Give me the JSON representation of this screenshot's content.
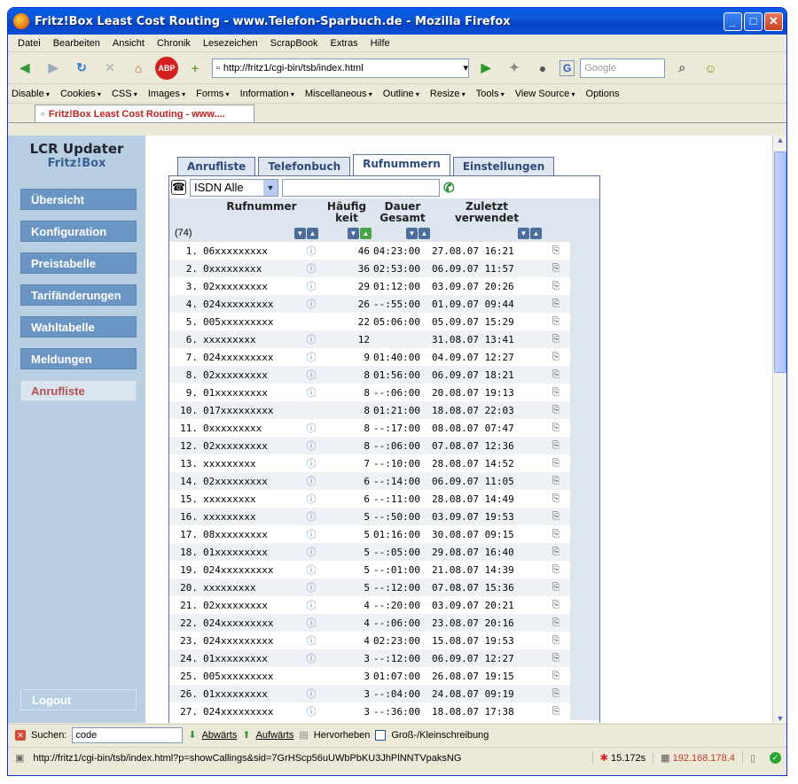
{
  "window": {
    "title": "Fritz!Box Least Cost Routing - www.Telefon-Sparbuch.de - Mozilla Firefox"
  },
  "menubar": [
    "Datei",
    "Bearbeiten",
    "Ansicht",
    "Chronik",
    "Lesezeichen",
    "ScrapBook",
    "Extras",
    "Hilfe"
  ],
  "navbar": {
    "url": "http://fritz1/cgi-bin/tsb/index.html",
    "search_engine": "G",
    "search_placeholder": "Google"
  },
  "devbar": [
    "Disable",
    "Cookies",
    "CSS",
    "Images",
    "Forms",
    "Information",
    "Miscellaneous",
    "Outline",
    "Resize",
    "Tools",
    "View Source",
    "Options"
  ],
  "browser_tab": {
    "label": "Fritz!Box Least Cost Routing - www...."
  },
  "sidebar": {
    "title": "LCR Updater",
    "subtitle": "Fritz!Box",
    "items": [
      {
        "label": "Übersicht",
        "active": false
      },
      {
        "label": "Konfiguration",
        "active": false
      },
      {
        "label": "Preistabelle",
        "active": false
      },
      {
        "label": "Tarifänderungen",
        "active": false
      },
      {
        "label": "Wahltabelle",
        "active": false
      },
      {
        "label": "Meldungen",
        "active": false
      },
      {
        "label": "Anrufliste",
        "active": true
      }
    ],
    "logout": "Logout"
  },
  "page_tabs": [
    {
      "label": "Anrufliste",
      "active": false
    },
    {
      "label": "Telefonbuch",
      "active": false
    },
    {
      "label": "Rufnummern",
      "active": true
    },
    {
      "label": "Einstellungen",
      "active": false
    }
  ],
  "filter": {
    "select_value": "ISDN Alle",
    "input_value": ""
  },
  "table": {
    "headers": {
      "number": "Rufnummer",
      "freq_line1": "Häufig",
      "freq_line2": "keit",
      "dur_line1": "Dauer",
      "dur_line2": "Gesamt",
      "last_line1": "Zuletzt",
      "last_line2": "verwendet"
    },
    "count": "(74)",
    "rows": [
      [
        "1.",
        "06xxxxxxxxx",
        true,
        "46",
        "04:23:00",
        "27.08.07 16:21"
      ],
      [
        "2.",
        "0xxxxxxxxx",
        true,
        "36",
        "02:53:00",
        "06.09.07 11:57"
      ],
      [
        "3.",
        "02xxxxxxxxx",
        true,
        "29",
        "01:12:00",
        "03.09.07 20:26"
      ],
      [
        "4.",
        "024xxxxxxxxx",
        true,
        "26",
        "--:55:00",
        "01.09.07 09:44"
      ],
      [
        "5.",
        "005xxxxxxxxx",
        false,
        "22",
        "05:06:00",
        "05.09.07 15:29"
      ],
      [
        "6.",
        "xxxxxxxxx",
        true,
        "12",
        "",
        "31.08.07 13:41"
      ],
      [
        "7.",
        "024xxxxxxxxx",
        true,
        "9",
        "01:40:00",
        "04.09.07 12:27"
      ],
      [
        "8.",
        "02xxxxxxxxx",
        true,
        "8",
        "01:56:00",
        "06.09.07 18:21"
      ],
      [
        "9.",
        "01xxxxxxxxx",
        true,
        "8",
        "--:06:00",
        "20.08.07 19:13"
      ],
      [
        "10.",
        "017xxxxxxxxx",
        false,
        "8",
        "01:21:00",
        "18.08.07 22:03"
      ],
      [
        "11.",
        "0xxxxxxxxx",
        true,
        "8",
        "--:17:00",
        "08.08.07 07:47"
      ],
      [
        "12.",
        "02xxxxxxxxx",
        true,
        "8",
        "--:06:00",
        "07.08.07 12:36"
      ],
      [
        "13.",
        "xxxxxxxxx",
        true,
        "7",
        "--:10:00",
        "28.08.07 14:52"
      ],
      [
        "14.",
        "02xxxxxxxxx",
        true,
        "6",
        "--:14:00",
        "06.09.07 11:05"
      ],
      [
        "15.",
        "xxxxxxxxx",
        true,
        "6",
        "--:11:00",
        "28.08.07 14:49"
      ],
      [
        "16.",
        "xxxxxxxxx",
        true,
        "5",
        "--:50:00",
        "03.09.07 19:53"
      ],
      [
        "17.",
        "08xxxxxxxxx",
        true,
        "5",
        "01:16:00",
        "30.08.07 09:15"
      ],
      [
        "18.",
        "01xxxxxxxxx",
        true,
        "5",
        "--:05:00",
        "29.08.07 16:40"
      ],
      [
        "19.",
        "024xxxxxxxxx",
        true,
        "5",
        "--:01:00",
        "21.08.07 14:39"
      ],
      [
        "20.",
        "xxxxxxxxx",
        true,
        "5",
        "--:12:00",
        "07.08.07 15:36"
      ],
      [
        "21.",
        "02xxxxxxxxx",
        true,
        "4",
        "--:20:00",
        "03.09.07 20:21"
      ],
      [
        "22.",
        "024xxxxxxxxx",
        true,
        "4",
        "--:06:00",
        "23.08.07 20:16"
      ],
      [
        "23.",
        "024xxxxxxxxx",
        true,
        "4",
        "02:23:00",
        "15.08.07 19:53"
      ],
      [
        "24.",
        "01xxxxxxxxx",
        true,
        "3",
        "--:12:00",
        "06.09.07 12:27"
      ],
      [
        "25.",
        "005xxxxxxxxx",
        false,
        "3",
        "01:07:00",
        "26.08.07 19:15"
      ],
      [
        "26.",
        "01xxxxxxxxx",
        true,
        "3",
        "--:04:00",
        "24.08.07 09:19"
      ],
      [
        "27.",
        "024xxxxxxxxx",
        true,
        "3",
        "--:36:00",
        "18.08.07 17:38"
      ]
    ]
  },
  "findbar": {
    "label": "Suchen:",
    "value": "code",
    "down": "Abwärts",
    "up": "Aufwärts",
    "highlight": "Hervorheben",
    "case": "Groß-/Kleinschreibung"
  },
  "statusbar": {
    "url": "http://fritz1/cgi-bin/tsb/index.html?p=showCallings&sid=7GrHScp56uUWbPbKU3JhPlNNTVpaksNG",
    "time": "15.172s",
    "ip": "192.168.178.4"
  }
}
